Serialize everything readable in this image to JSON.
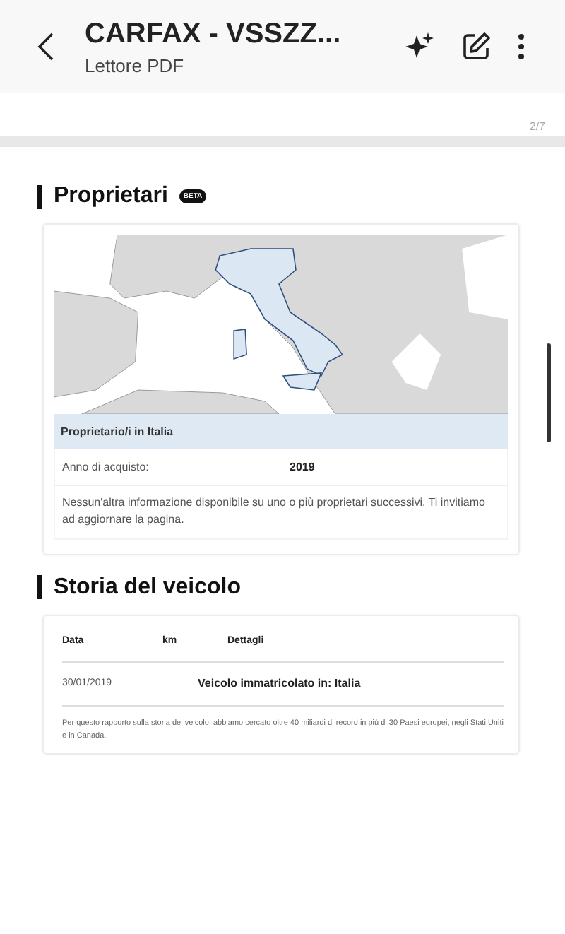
{
  "header": {
    "title": "CARFAX - VSSZZ...",
    "subtitle": "Lettore PDF"
  },
  "page_indicator": "2/7",
  "owners": {
    "title": "Proprietari",
    "badge": "BETA",
    "region": "Proprietario/i in Italia",
    "rows": [
      {
        "label": "Anno di acquisto:",
        "value": "2019"
      }
    ],
    "note": "Nessun'altra informazione disponibile su uno o più proprietari successivi. Ti invitiamo ad aggiornare la pagina."
  },
  "history": {
    "title": "Storia del veicolo",
    "columns": [
      "Data",
      "km",
      "Dettagli"
    ],
    "rows": [
      {
        "date": "30/01/2019",
        "details": "Veicolo immatricolato in: Italia"
      }
    ],
    "footnote": "Per questo rapporto sulla storia del veicolo, abbiamo cercato oltre 40 miliardi di record in più di 30 Paesi europei, negli Stati Uniti e in Canada."
  }
}
